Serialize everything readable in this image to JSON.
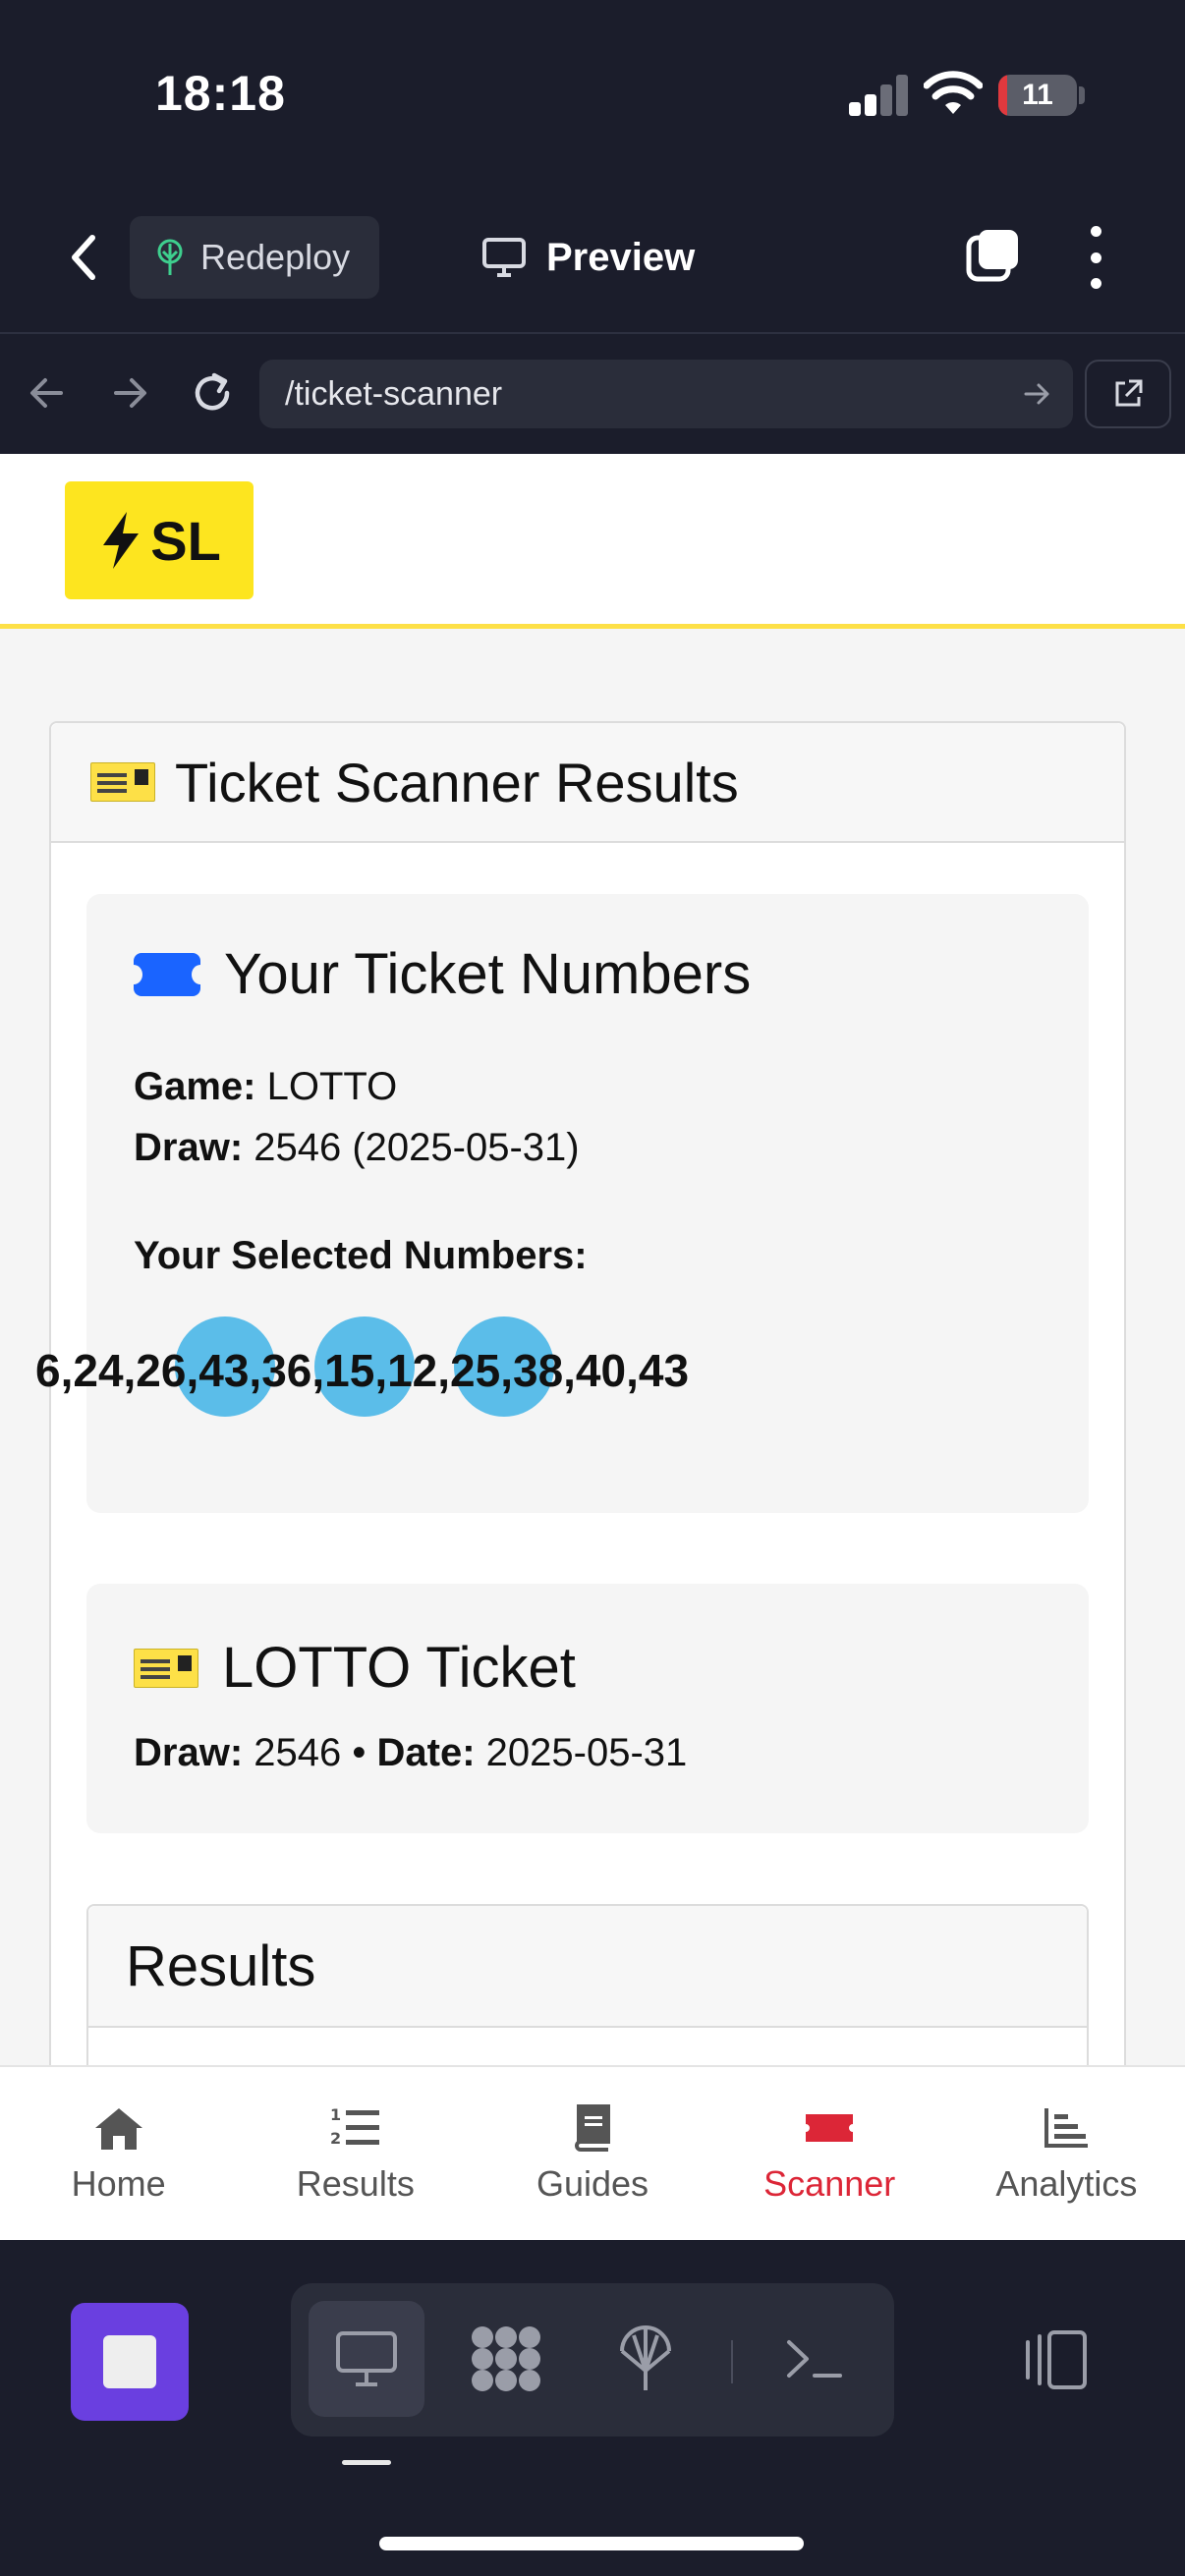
{
  "status_bar": {
    "time": "18:18",
    "battery": "11",
    "battery_level": 0.11
  },
  "app_header": {
    "redeploy_label": "Redeploy",
    "preview_label": "Preview"
  },
  "url_bar": {
    "url": "/ticket-scanner"
  },
  "site": {
    "logo_text": "SL"
  },
  "scanner": {
    "card_title": "Ticket Scanner Results",
    "ticket_panel": {
      "heading": "Your Ticket Numbers",
      "game_label": "Game:",
      "game_value": "LOTTO",
      "draw_label": "Draw:",
      "draw_value": "2546 (2025-05-31)",
      "selected_label": "Your Selected Numbers:",
      "numbers_text": "6,24,26,43,36,15,12,25,38,40,43"
    },
    "lotto_panel": {
      "heading": "LOTTO Ticket",
      "draw_label": "Draw:",
      "draw_value": "2546",
      "separator": "•",
      "date_label": "Date:",
      "date_value": "2025-05-31"
    },
    "results_heading": "Results"
  },
  "bottom_nav": {
    "items": [
      {
        "label": "Home",
        "icon": "home-icon"
      },
      {
        "label": "Results",
        "icon": "ordered-list-icon"
      },
      {
        "label": "Guides",
        "icon": "book-icon"
      },
      {
        "label": "Scanner",
        "icon": "ticket-icon",
        "active": true
      },
      {
        "label": "Analytics",
        "icon": "bar-chart-icon"
      }
    ],
    "active_color": "#dc2637"
  },
  "colors": {
    "accent_yellow": "#fde047",
    "ball_blue": "#5bbde9",
    "stop_purple": "#6a3fe0"
  }
}
